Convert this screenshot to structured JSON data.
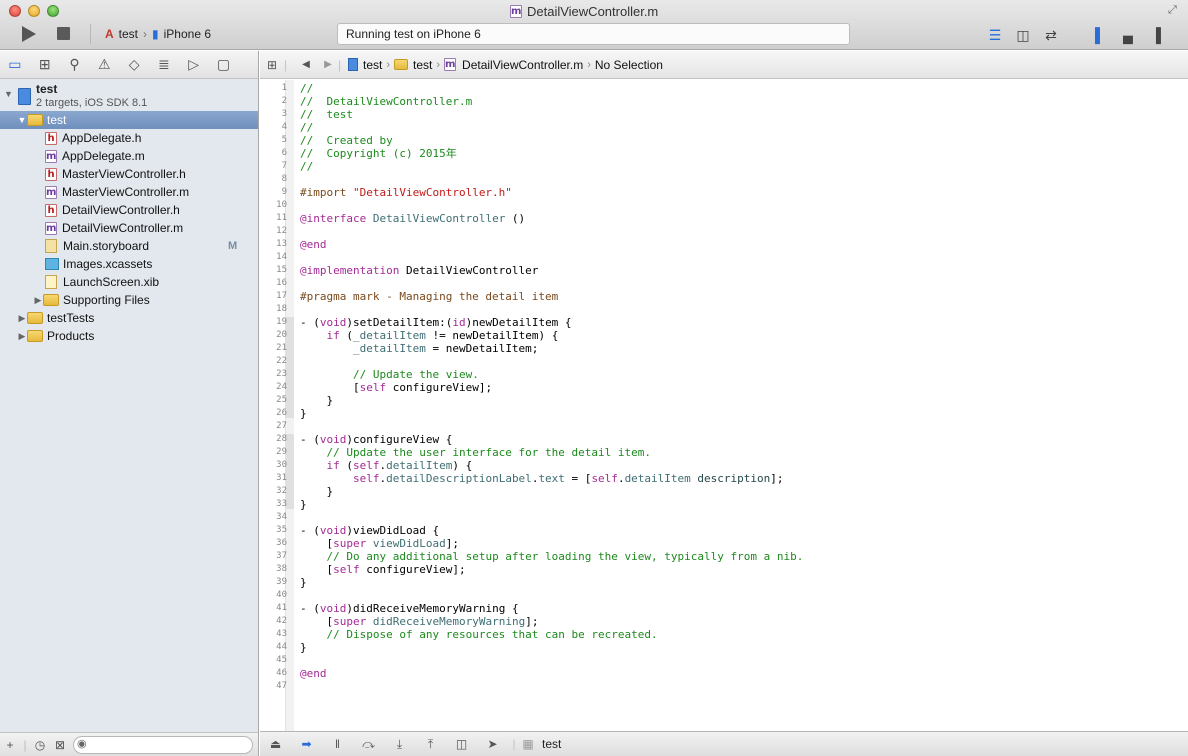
{
  "window": {
    "title": "DetailViewController.m"
  },
  "toolbar": {
    "scheme": "test",
    "device": "iPhone 6",
    "activity": "Running test on iPhone 6"
  },
  "navigator": {
    "project": {
      "name": "test",
      "subtitle": "2 targets, iOS SDK 8.1"
    },
    "items": [
      {
        "label": "test",
        "kind": "folder",
        "expanded": true,
        "selected": true,
        "depth": 1
      },
      {
        "label": "AppDelegate.h",
        "kind": "h",
        "depth": 2
      },
      {
        "label": "AppDelegate.m",
        "kind": "m",
        "depth": 2
      },
      {
        "label": "MasterViewController.h",
        "kind": "h",
        "depth": 2
      },
      {
        "label": "MasterViewController.m",
        "kind": "m",
        "depth": 2
      },
      {
        "label": "DetailViewController.h",
        "kind": "h",
        "depth": 2
      },
      {
        "label": "DetailViewController.m",
        "kind": "m",
        "depth": 2
      },
      {
        "label": "Main.storyboard",
        "kind": "storyboard",
        "depth": 2,
        "badge": "M"
      },
      {
        "label": "Images.xcassets",
        "kind": "xcassets",
        "depth": 2
      },
      {
        "label": "LaunchScreen.xib",
        "kind": "xib",
        "depth": 2
      },
      {
        "label": "Supporting Files",
        "kind": "folder",
        "expanded": false,
        "depth": 2
      },
      {
        "label": "testTests",
        "kind": "folder",
        "expanded": false,
        "depth": 1
      },
      {
        "label": "Products",
        "kind": "folder",
        "expanded": false,
        "depth": 1
      }
    ]
  },
  "jumpbar": {
    "crumbs": [
      "test",
      "test",
      "DetailViewController.m",
      "No Selection"
    ]
  },
  "editor": {
    "lines": [
      [
        [
          "cm",
          "//"
        ]
      ],
      [
        [
          "cm",
          "//  DetailViewController.m"
        ]
      ],
      [
        [
          "cm",
          "//  test"
        ]
      ],
      [
        [
          "cm",
          "//"
        ]
      ],
      [
        [
          "cm",
          "//  Created by"
        ]
      ],
      [
        [
          "cm",
          "//  Copyright (c) 2015年"
        ]
      ],
      [
        [
          "cm",
          "//"
        ]
      ],
      [],
      [
        [
          "pp",
          "#import "
        ],
        [
          "st",
          "\"DetailViewController.h\""
        ]
      ],
      [],
      [
        [
          "kw",
          "@interface "
        ],
        [
          "ty",
          "DetailViewController"
        ],
        [
          "",
          " ()"
        ]
      ],
      [],
      [
        [
          "kw",
          "@end"
        ]
      ],
      [],
      [
        [
          "kw",
          "@implementation "
        ],
        [
          "",
          "DetailViewController"
        ]
      ],
      [],
      [
        [
          "pp",
          "#pragma mark - Managing the detail item"
        ]
      ],
      [],
      [
        [
          "",
          "- ("
        ],
        [
          "kw",
          "void"
        ],
        [
          "",
          ")setDetailItem:("
        ],
        [
          "kw",
          "id"
        ],
        [
          "",
          ")newDetailItem {"
        ]
      ],
      [
        [
          "",
          "    "
        ],
        [
          "kw",
          "if"
        ],
        [
          "",
          " ("
        ],
        [
          "pr",
          "_detailItem"
        ],
        [
          "",
          " != newDetailItem) {"
        ]
      ],
      [
        [
          "",
          "        "
        ],
        [
          "pr",
          "_detailItem"
        ],
        [
          "",
          " = newDetailItem;"
        ]
      ],
      [],
      [
        [
          "",
          "        "
        ],
        [
          "cm",
          "// Update the view."
        ]
      ],
      [
        [
          "",
          "        ["
        ],
        [
          "kw",
          "self"
        ],
        [
          "",
          " configureView];"
        ]
      ],
      [
        [
          "",
          "    }"
        ]
      ],
      [
        [
          "",
          "}"
        ]
      ],
      [],
      [
        [
          "",
          "- ("
        ],
        [
          "kw",
          "void"
        ],
        [
          "",
          ")configureView {"
        ]
      ],
      [
        [
          "",
          "    "
        ],
        [
          "cm",
          "// Update the user interface for the detail item."
        ]
      ],
      [
        [
          "",
          "    "
        ],
        [
          "kw",
          "if"
        ],
        [
          "",
          " ("
        ],
        [
          "kw",
          "self"
        ],
        [
          "",
          "."
        ],
        [
          "pr",
          "detailItem"
        ],
        [
          "",
          ") {"
        ]
      ],
      [
        [
          "",
          "        "
        ],
        [
          "kw",
          "self"
        ],
        [
          "",
          "."
        ],
        [
          "pr",
          "detailDescriptionLabel"
        ],
        [
          "",
          "."
        ],
        [
          "pr",
          "text"
        ],
        [
          "",
          " = ["
        ],
        [
          "kw",
          "self"
        ],
        [
          "",
          "."
        ],
        [
          "pr",
          "detailItem"
        ],
        [
          "",
          " "
        ],
        [
          "ms",
          "description"
        ],
        [
          "",
          "];"
        ]
      ],
      [
        [
          "",
          "    }"
        ]
      ],
      [
        [
          "",
          "}"
        ]
      ],
      [],
      [
        [
          "",
          "- ("
        ],
        [
          "kw",
          "void"
        ],
        [
          "",
          ")viewDidLoad {"
        ]
      ],
      [
        [
          "",
          "    ["
        ],
        [
          "kw",
          "super"
        ],
        [
          "",
          " "
        ],
        [
          "pr",
          "viewDidLoad"
        ],
        [
          "",
          "];"
        ]
      ],
      [
        [
          "",
          "    "
        ],
        [
          "cm",
          "// Do any additional setup after loading the view, typically from a nib."
        ]
      ],
      [
        [
          "",
          "    ["
        ],
        [
          "kw",
          "self"
        ],
        [
          "",
          " configureView];"
        ]
      ],
      [
        [
          "",
          "}"
        ]
      ],
      [],
      [
        [
          "",
          "- ("
        ],
        [
          "kw",
          "void"
        ],
        [
          "",
          ")didReceiveMemoryWarning {"
        ]
      ],
      [
        [
          "",
          "    ["
        ],
        [
          "kw",
          "super"
        ],
        [
          "",
          " "
        ],
        [
          "pr",
          "didReceiveMemoryWarning"
        ],
        [
          "",
          "];"
        ]
      ],
      [
        [
          "",
          "    "
        ],
        [
          "cm",
          "// Dispose of any resources that can be recreated."
        ]
      ],
      [
        [
          "",
          "}"
        ]
      ],
      [],
      [
        [
          "kw",
          "@end"
        ]
      ],
      []
    ]
  },
  "debug": {
    "target": "test"
  }
}
